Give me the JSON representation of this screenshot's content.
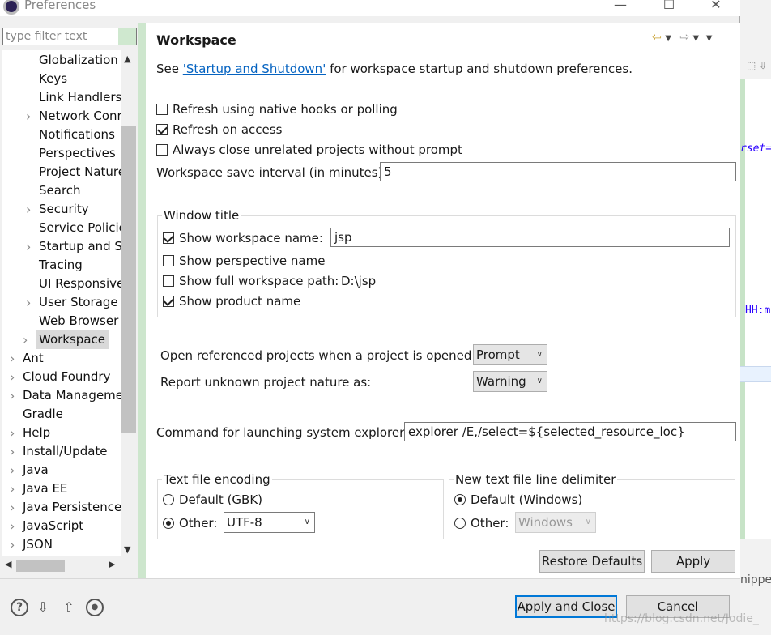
{
  "window": {
    "title": "Preferences",
    "minimize": "—",
    "maximize": "☐",
    "close": "✕"
  },
  "filter": {
    "placeholder": "type filter text"
  },
  "tree": [
    {
      "label": "Globalization",
      "expandable": false
    },
    {
      "label": "Keys",
      "expandable": false
    },
    {
      "label": "Link Handlers",
      "expandable": false
    },
    {
      "label": "Network Conr",
      "expandable": true
    },
    {
      "label": "Notifications",
      "expandable": false
    },
    {
      "label": "Perspectives",
      "expandable": false
    },
    {
      "label": "Project Nature",
      "expandable": false
    },
    {
      "label": "Search",
      "expandable": false
    },
    {
      "label": "Security",
      "expandable": true
    },
    {
      "label": "Service Policie",
      "expandable": false
    },
    {
      "label": "Startup and Sl",
      "expandable": true
    },
    {
      "label": "Tracing",
      "expandable": false
    },
    {
      "label": "UI Responsive",
      "expandable": false
    },
    {
      "label": "User Storage",
      "expandable": true
    },
    {
      "label": "Web Browser",
      "expandable": false
    },
    {
      "label": "Workspace",
      "expandable": true,
      "selected": true
    },
    {
      "label": "Ant",
      "expandable": true
    },
    {
      "label": "Cloud Foundry",
      "expandable": true
    },
    {
      "label": "Data Manageme",
      "expandable": true
    },
    {
      "label": "Gradle",
      "expandable": false
    },
    {
      "label": "Help",
      "expandable": true
    },
    {
      "label": "Install/Update",
      "expandable": true
    },
    {
      "label": "Java",
      "expandable": true
    },
    {
      "label": "Java EE",
      "expandable": true
    },
    {
      "label": "Java Persistence",
      "expandable": true
    },
    {
      "label": "JavaScript",
      "expandable": true
    },
    {
      "label": "JSON",
      "expandable": true
    }
  ],
  "page": {
    "title": "Workspace",
    "desc_prefix": "See ",
    "desc_link": "'Startup and Shutdown'",
    "desc_suffix": " for workspace startup and shutdown preferences.",
    "options": {
      "refresh_native": {
        "label": "Refresh using native hooks or polling",
        "checked": false
      },
      "refresh_access": {
        "label": "Refresh on access",
        "checked": true
      },
      "always_close": {
        "label": "Always close unrelated projects without prompt",
        "checked": false
      }
    },
    "save_interval_label": "Workspace save interval (in minutes):",
    "save_interval_value": "5",
    "window_title": {
      "label": "Window title",
      "show_workspace_name": {
        "label": "Show workspace name:",
        "checked": true,
        "value": "jsp"
      },
      "show_perspective_name": {
        "label": "Show perspective name",
        "checked": false
      },
      "show_full_path": {
        "label": "Show full workspace path:",
        "checked": false,
        "value": "D:\\jsp"
      },
      "show_product_name": {
        "label": "Show product name",
        "checked": true
      }
    },
    "open_referenced_label": "Open referenced projects when a project is opened:",
    "open_referenced_value": "Prompt",
    "report_unknown_label": "Report unknown project nature as:",
    "report_unknown_value": "Warning",
    "explorer_label": "Command for launching system explorer:",
    "explorer_value": "explorer /E,/select=${selected_resource_loc}",
    "encoding": {
      "label": "Text file encoding",
      "default_label": "Default (GBK)",
      "other_label": "Other:",
      "other_value": "UTF-8",
      "selected": "other"
    },
    "delimiter": {
      "label": "New text file line delimiter",
      "default_label": "Default (Windows)",
      "other_label": "Other:",
      "other_value": "Windows",
      "selected": "default"
    },
    "restore_defaults": "Restore Defaults",
    "apply": "Apply"
  },
  "footer": {
    "apply_and_close": "Apply and Close",
    "cancel": "Cancel",
    "help_icon": "?"
  },
  "background": {
    "code1": "rset=",
    "code2": "HH:m",
    "code3": "nippe",
    "watermark": "https://blog.csdn.net/Jodie_"
  }
}
